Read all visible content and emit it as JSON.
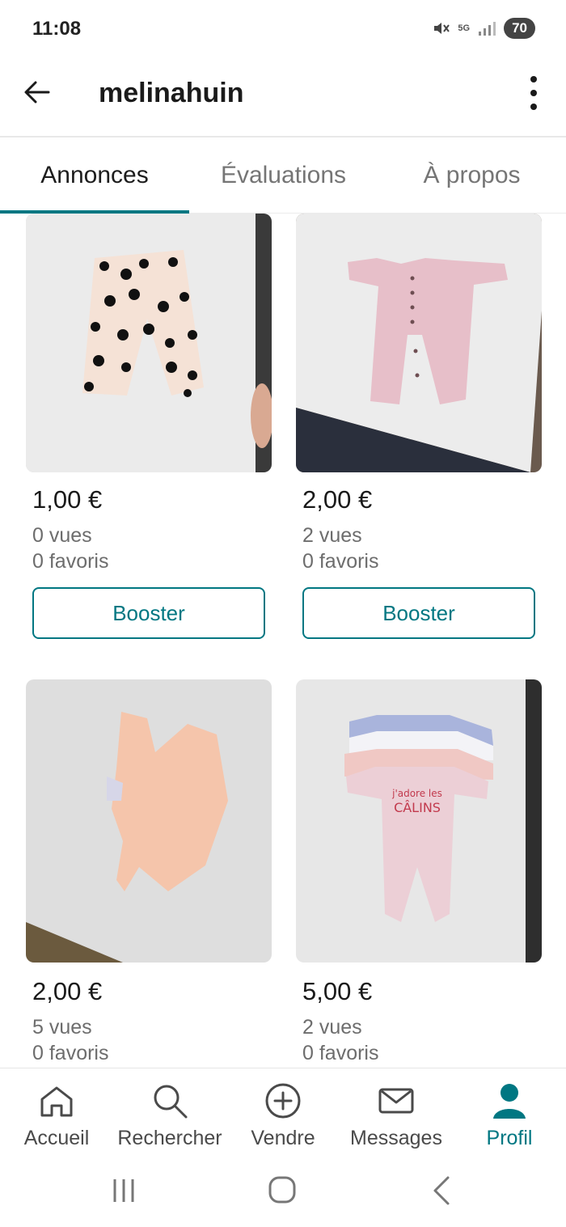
{
  "status_bar": {
    "time": "11:08",
    "network": "5G",
    "battery": "70"
  },
  "header": {
    "username": "melinahuin"
  },
  "tabs": [
    {
      "label": "Annonces",
      "active": true
    },
    {
      "label": "Évaluations",
      "active": false
    },
    {
      "label": "À propos",
      "active": false
    }
  ],
  "listings": [
    {
      "price": "1,00 €",
      "views": "0 vues",
      "favorites": "0 favoris",
      "boost_label": "Booster",
      "photo_desc": "polka-dot baby leggings"
    },
    {
      "price": "2,00 €",
      "views": "2 vues",
      "favorites": "0 favoris",
      "boost_label": "Booster",
      "photo_desc": "pink baby onesie"
    },
    {
      "price": "2,00 €",
      "views": "5 vues",
      "favorites": "0 favoris",
      "photo_desc": "pink baby dress"
    },
    {
      "price": "5,00 €",
      "views": "2 vues",
      "favorites": "0 favoris",
      "photo_desc": "stack of baby bodysuits",
      "photo_print": {
        "line1": "j'adore les",
        "line2": "CÂLINS"
      }
    }
  ],
  "bottom_nav": [
    {
      "label": "Accueil",
      "icon": "home-icon",
      "active": false
    },
    {
      "label": "Rechercher",
      "icon": "search-icon",
      "active": false
    },
    {
      "label": "Vendre",
      "icon": "plus-circle-icon",
      "active": false
    },
    {
      "label": "Messages",
      "icon": "mail-icon",
      "active": false
    },
    {
      "label": "Profil",
      "icon": "profile-icon",
      "active": true
    }
  ],
  "colors": {
    "accent": "#007782",
    "text_primary": "#1a1a1a",
    "text_secondary": "#6d6d6d"
  }
}
